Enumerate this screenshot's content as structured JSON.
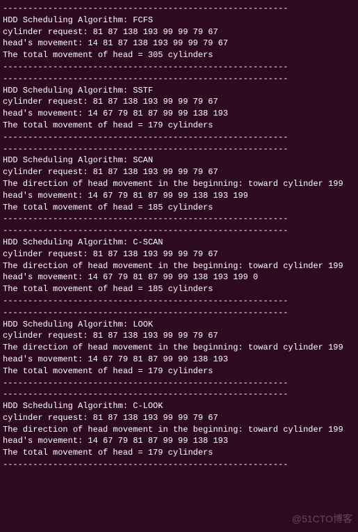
{
  "separator": "---------------------------------------------------------",
  "algorithms": [
    {
      "name": "FCFS",
      "request": "81 87 138 193 99 99 79 67",
      "direction": null,
      "movement": "14 81 87 138 193 99 99 79 67",
      "total": "305"
    },
    {
      "name": "SSTF",
      "request": "81 87 138 193 99 99 79 67",
      "direction": null,
      "movement": "14 67 79 81 87 99 99 138 193",
      "total": "179"
    },
    {
      "name": "SCAN",
      "request": "81 87 138 193 99 99 79 67",
      "direction": "toward cylinder 199",
      "movement": "14 67 79 81 87 99 99 138 193 199",
      "total": "185"
    },
    {
      "name": "C-SCAN",
      "request": "81 87 138 193 99 99 79 67",
      "direction": "toward cylinder 199",
      "movement": "14 67 79 81 87 99 99 138 193 199 0",
      "total": "185"
    },
    {
      "name": "LOOK",
      "request": "81 87 138 193 99 99 79 67",
      "direction": "toward cylinder 199",
      "movement": "14 67 79 81 87 99 99 138 193",
      "total": "179"
    },
    {
      "name": "C-LOOK",
      "request": "81 87 138 193 99 99 79 67",
      "direction": "toward cylinder 199",
      "movement": "14 67 79 81 87 99 99 138 193",
      "total": "179"
    }
  ],
  "labels": {
    "algo_prefix": "HDD Scheduling Algorithm: ",
    "request_prefix": "cylinder request: ",
    "direction_prefix": "The direction of head movement in the beginning: ",
    "movement_prefix": "head's movement: ",
    "total_prefix": "The total movement of head = ",
    "total_suffix": " cylinders"
  },
  "watermark": "@51CTO博客"
}
